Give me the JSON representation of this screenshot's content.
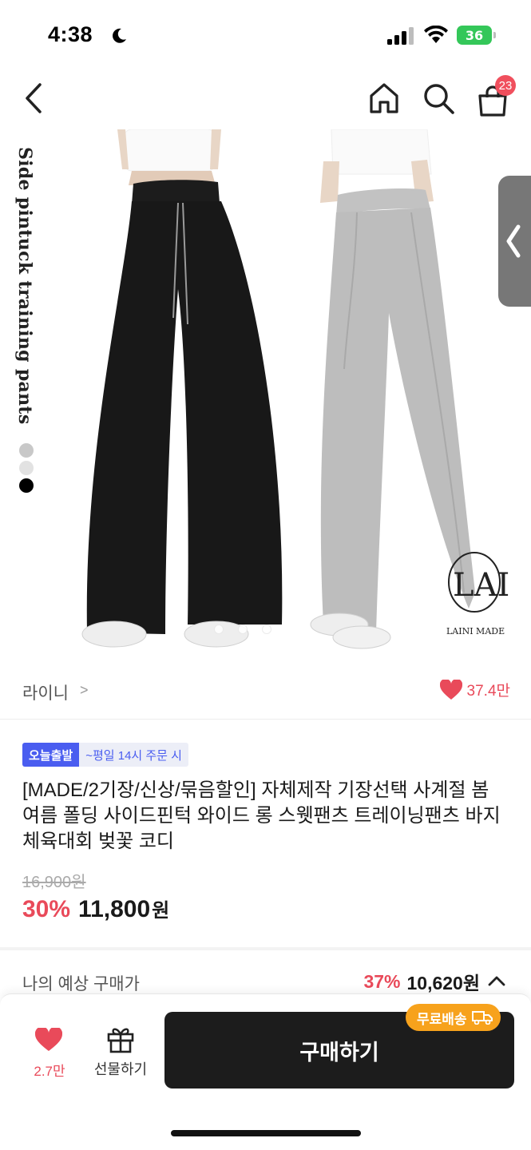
{
  "status_bar": {
    "time": "4:38",
    "battery": "36"
  },
  "nav": {
    "cart_count": "23"
  },
  "hero": {
    "caption": "Side pintuck training pants",
    "logo_text": "LAINI MADE",
    "logo_monogram": "LAI",
    "swatch_colors": [
      "#c8c8c8",
      "#e2e2e2",
      "#000000"
    ]
  },
  "seller": {
    "name": "라이니",
    "chevron": ">",
    "likes": "37.4만"
  },
  "product": {
    "tag_today": "오늘출발",
    "tag_note": "~평일 14시 주문 시",
    "title": "[MADE/2기장/신상/묶음할인] 자체제작 기장선택 사계절 봄 여름 폴딩 사이드핀턱 와이드 롱 스웻팬츠 트레이닝팬츠 바지 체육대회 벚꽃 코디",
    "original_price": "16,900원",
    "discount": "30%",
    "price": "11,800",
    "price_unit": "원"
  },
  "expected": {
    "label": "나의 예상 구매가",
    "rate": "37%",
    "price": "10,620원"
  },
  "bottom_bar": {
    "wish_count": "2.7만",
    "gift_label": "선물하기",
    "buy_label": "구매하기",
    "free_shipping": "무료배송"
  },
  "colors": {
    "accent_red": "#e94a5a",
    "tag_blue": "#4a5df0",
    "shipping_orange": "#f7a21c",
    "buy_button": "#1c1c1c"
  }
}
